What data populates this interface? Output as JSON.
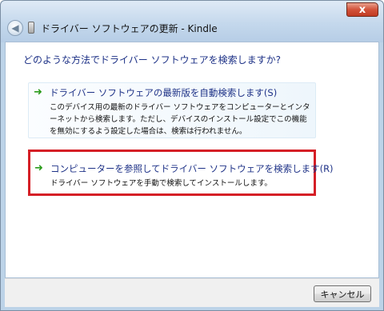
{
  "window": {
    "title": "ドライバー ソフトウェアの更新 - Kindle",
    "close_label": "x"
  },
  "main": {
    "question": "どのような方法でドライバー ソフトウェアを検索しますか?",
    "options": [
      {
        "title": "ドライバー ソフトウェアの最新版を自動検索します(S)",
        "description": "このデバイス用の最新のドライバー ソフトウェアをコンピューターとインターネットから検索します。ただし、デバイスのインストール設定でこの機能を無効にするよう設定した場合は、検索は行われません。",
        "icon": "green-arrow-icon"
      },
      {
        "title": "コンピューターを参照してドライバー ソフトウェアを検索します(R)",
        "description": "ドライバー ソフトウェアを手動で検索してインストールします。",
        "icon": "green-arrow-icon",
        "highlight_color": "#d51f26"
      }
    ]
  },
  "footer": {
    "cancel_label": "キャンセル"
  },
  "colors": {
    "link_blue": "#1e3287",
    "arrow_green": "#2a9b1a",
    "highlight_red": "#d51f26",
    "close_red": "#c13a22"
  }
}
